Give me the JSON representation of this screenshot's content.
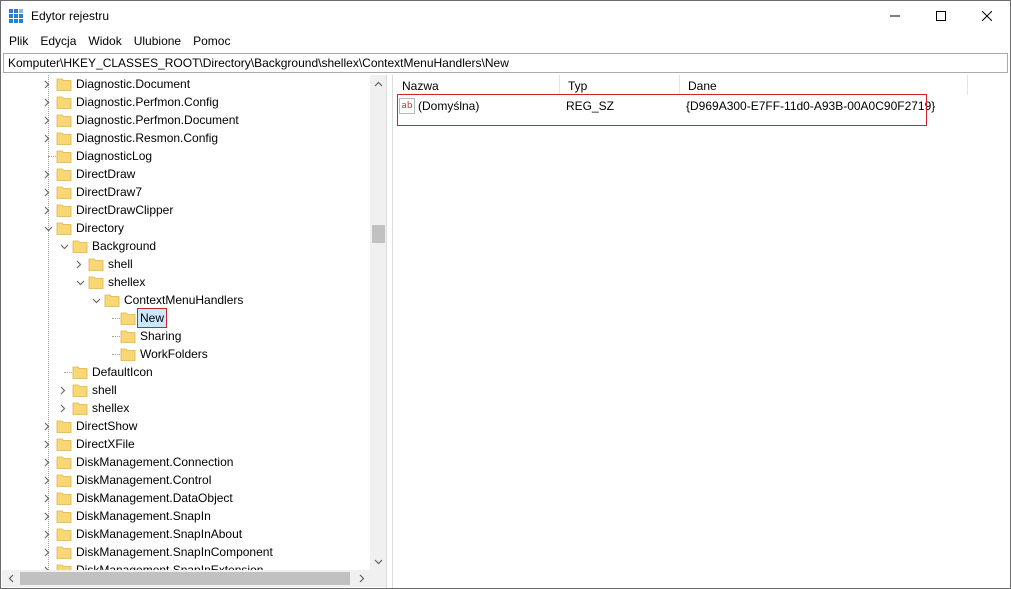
{
  "window": {
    "title": "Edytor rejestru",
    "accent": "#0078d7"
  },
  "menu": [
    {
      "label": "Plik"
    },
    {
      "label": "Edycja"
    },
    {
      "label": "Widok"
    },
    {
      "label": "Ulubione"
    },
    {
      "label": "Pomoc"
    }
  ],
  "address": {
    "path": "Komputer\\HKEY_CLASSES_ROOT\\Directory\\Background\\shellex\\ContextMenuHandlers\\New"
  },
  "tree": {
    "nodes": [
      {
        "label": "Diagnostic.Document",
        "depth": 0,
        "expander": "collapsed"
      },
      {
        "label": "Diagnostic.Perfmon.Config",
        "depth": 0,
        "expander": "collapsed"
      },
      {
        "label": "Diagnostic.Perfmon.Document",
        "depth": 0,
        "expander": "collapsed"
      },
      {
        "label": "Diagnostic.Resmon.Config",
        "depth": 0,
        "expander": "collapsed"
      },
      {
        "label": "DiagnosticLog",
        "depth": 0,
        "expander": "none"
      },
      {
        "label": "DirectDraw",
        "depth": 0,
        "expander": "collapsed"
      },
      {
        "label": "DirectDraw7",
        "depth": 0,
        "expander": "collapsed"
      },
      {
        "label": "DirectDrawClipper",
        "depth": 0,
        "expander": "collapsed"
      },
      {
        "label": "Directory",
        "depth": 0,
        "expander": "expanded"
      },
      {
        "label": "Background",
        "depth": 1,
        "expander": "expanded"
      },
      {
        "label": "shell",
        "depth": 2,
        "expander": "collapsed"
      },
      {
        "label": "shellex",
        "depth": 2,
        "expander": "expanded"
      },
      {
        "label": "ContextMenuHandlers",
        "depth": 3,
        "expander": "expanded"
      },
      {
        "label": "New",
        "depth": 4,
        "expander": "none",
        "selected": true
      },
      {
        "label": "Sharing",
        "depth": 4,
        "expander": "none"
      },
      {
        "label": "WorkFolders",
        "depth": 4,
        "expander": "none"
      },
      {
        "label": "DefaultIcon",
        "depth": 1,
        "expander": "none"
      },
      {
        "label": "shell",
        "depth": 1,
        "expander": "collapsed"
      },
      {
        "label": "shellex",
        "depth": 1,
        "expander": "collapsed"
      },
      {
        "label": "DirectShow",
        "depth": 0,
        "expander": "collapsed"
      },
      {
        "label": "DirectXFile",
        "depth": 0,
        "expander": "collapsed"
      },
      {
        "label": "DiskManagement.Connection",
        "depth": 0,
        "expander": "collapsed"
      },
      {
        "label": "DiskManagement.Control",
        "depth": 0,
        "expander": "collapsed"
      },
      {
        "label": "DiskManagement.DataObject",
        "depth": 0,
        "expander": "collapsed"
      },
      {
        "label": "DiskManagement.SnapIn",
        "depth": 0,
        "expander": "collapsed"
      },
      {
        "label": "DiskManagement.SnapInAbout",
        "depth": 0,
        "expander": "collapsed"
      },
      {
        "label": "DiskManagement.SnapInComponent",
        "depth": 0,
        "expander": "collapsed"
      },
      {
        "label": "DiskManagement.SnapInExtension",
        "depth": 0,
        "expander": "collapsed"
      }
    ]
  },
  "values": {
    "columns": [
      {
        "label": "Nazwa"
      },
      {
        "label": "Typ"
      },
      {
        "label": "Dane"
      }
    ],
    "rows": [
      {
        "name": "(Domyślna)",
        "type": "REG_SZ",
        "data": "{D969A300-E7FF-11d0-A93B-00A0C90F2719}",
        "icon": "string-value-icon"
      }
    ]
  },
  "colors": {
    "highlight_border": "#d0232c",
    "selection_bg": "#cce8ff",
    "folder": "#f8d775"
  }
}
